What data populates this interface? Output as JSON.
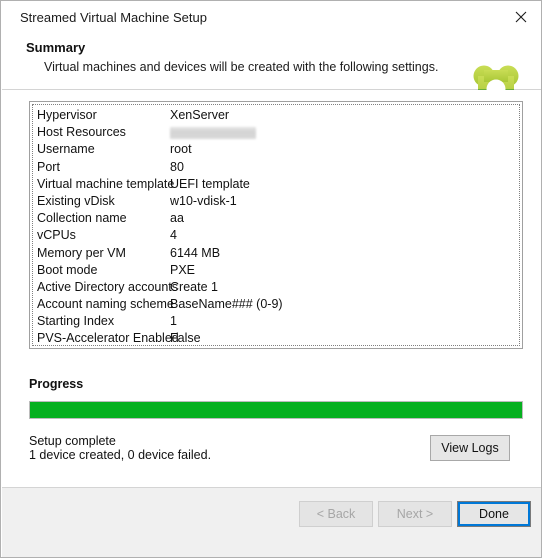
{
  "window": {
    "title": "Streamed Virtual Machine Setup",
    "close_icon": "close-icon"
  },
  "header": {
    "title": "Summary",
    "subtitle": "Virtual machines and devices will be created with the following settings.",
    "logo_icon": "citrix-logo-icon",
    "logo_colors": {
      "top_light": "#c2d94a",
      "top_mid": "#a8c63a",
      "bottom_mid": "#5aa638",
      "bottom_dark": "#3f8b2e"
    }
  },
  "settings": {
    "rows": [
      {
        "label": "Hypervisor",
        "value": "XenServer",
        "redacted": false
      },
      {
        "label": "Host Resources",
        "value": "",
        "redacted": true
      },
      {
        "label": "Username",
        "value": "root",
        "redacted": false
      },
      {
        "label": "Port",
        "value": "80",
        "redacted": false
      },
      {
        "label": "Virtual machine template",
        "value": "UEFI template",
        "redacted": false
      },
      {
        "label": "Existing vDisk",
        "value": "w10-vdisk-1",
        "redacted": false
      },
      {
        "label": "Collection name",
        "value": "aa",
        "redacted": false
      },
      {
        "label": "vCPUs",
        "value": "4",
        "redacted": false
      },
      {
        "label": "Memory per VM",
        "value": "6144 MB",
        "redacted": false
      },
      {
        "label": "Boot mode",
        "value": "PXE",
        "redacted": false
      },
      {
        "label": "Active Directory accounts",
        "value": "Create 1",
        "redacted": false
      },
      {
        "label": "Account naming scheme",
        "value": "BaseName###  (0-9)",
        "redacted": false
      },
      {
        "label": "Starting Index",
        "value": "1",
        "redacted": false
      },
      {
        "label": "PVS-Accelerator Enabled",
        "value": "False",
        "redacted": false
      }
    ]
  },
  "progress": {
    "title": "Progress",
    "percent": 100,
    "bar_color": "#06b020",
    "status_line_1": "Setup complete",
    "status_line_2": "1 device created, 0 device failed.",
    "view_logs_label": "View Logs"
  },
  "footer": {
    "back_label": "< Back",
    "next_label": "Next >",
    "done_label": "Done",
    "focus_color": "#0078d7"
  }
}
